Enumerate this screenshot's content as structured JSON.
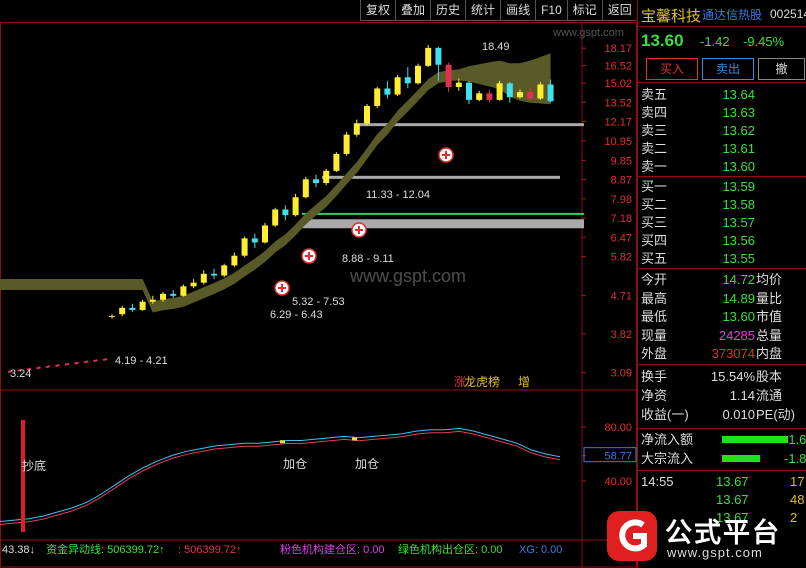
{
  "toolbar": [
    "复权",
    "叠加",
    "历史",
    "统计",
    "画线",
    "F10",
    "标记",
    "返回"
  ],
  "stock": {
    "name": "宝馨科技",
    "tag": "通达信热股",
    "code": "002514",
    "price": "13.60",
    "change": "-1.42",
    "pct": "-9.45%"
  },
  "trade_buttons": [
    "买入",
    "卖出",
    "撤"
  ],
  "asks": [
    {
      "label": "卖五",
      "price": "13.64"
    },
    {
      "label": "卖四",
      "price": "13.63"
    },
    {
      "label": "卖三",
      "price": "13.62"
    },
    {
      "label": "卖二",
      "price": "13.61"
    },
    {
      "label": "卖一",
      "price": "13.60"
    }
  ],
  "bids": [
    {
      "label": "买一",
      "price": "13.59"
    },
    {
      "label": "买二",
      "price": "13.58"
    },
    {
      "label": "买三",
      "price": "13.57"
    },
    {
      "label": "买四",
      "price": "13.56"
    },
    {
      "label": "买五",
      "price": "13.55"
    }
  ],
  "stats": [
    {
      "label": "今开",
      "value": "14.72",
      "label2": "均价"
    },
    {
      "label": "最高",
      "value": "14.89",
      "label2": "量比"
    },
    {
      "label": "最低",
      "value": "13.60",
      "label2": "市值"
    },
    {
      "label": "现量",
      "value": "24285",
      "label2": "总量"
    },
    {
      "label": "外盘",
      "value": "373074",
      "label2": "内盘"
    }
  ],
  "stats2": [
    {
      "label": "换手",
      "value": "15.54%",
      "label2": "股本"
    },
    {
      "label": "净资",
      "value": "1.14",
      "label2": "流通"
    },
    {
      "label": "收益(一)",
      "value": "0.010",
      "label2": "PE(动)"
    }
  ],
  "flows": [
    {
      "label": "净流入额",
      "value": "-1.6"
    },
    {
      "label": "大宗流入",
      "value": "-1.8"
    }
  ],
  "ticks": [
    {
      "time": "14:55",
      "price": "13.67",
      "vol": "17"
    },
    {
      "time": "",
      "price": "13.67",
      "vol": "48"
    },
    {
      "time": "",
      "price": "13.67",
      "vol": "2"
    }
  ],
  "price_axis": [
    "18.17",
    "16.52",
    "15.02",
    "13.52",
    "12.17",
    "10.95",
    "9.85",
    "8.87",
    "7.98",
    "7.18",
    "6.47",
    "5.82",
    "4.71",
    "3.82",
    "3.09"
  ],
  "ind_axis": [
    "80.00",
    "58.77",
    "40.00"
  ],
  "annotations": {
    "high": "18.49",
    "low": "3.24",
    "r1": "11.33 - 12.04",
    "r2": "8.88 - 9.11",
    "r3": "5.32 - 7.53",
    "r4": "6.29 - 6.43",
    "r5": "4.19 - 4.21",
    "zt": "涨",
    "bang": "龙虎榜",
    "zeng": "增"
  },
  "signals": [
    "抄底",
    "加仓",
    "加仓"
  ],
  "legend": {
    "prefix": "43.38↓",
    "s1": "资金异动线: 506399.72↑",
    "s2": ": 506399.72↑",
    "s3": "粉色机构建仓区: 0.00",
    "s4": "绿色机构出仓区: 0.00",
    "s5": "XG: 0.00"
  },
  "logo": {
    "name": "公式平台",
    "url": "www.gspt.com"
  },
  "watermark": "www.gspt.com",
  "chart_data": {
    "type": "candlestick",
    "candles": [
      [
        4.19,
        4.21,
        4.15,
        4.25
      ],
      [
        4.25,
        4.4,
        4.2,
        4.45
      ],
      [
        4.4,
        4.35,
        4.3,
        4.5
      ],
      [
        4.35,
        4.55,
        4.33,
        4.6
      ],
      [
        4.55,
        4.6,
        4.5,
        4.7
      ],
      [
        4.6,
        4.75,
        4.55,
        4.8
      ],
      [
        4.75,
        4.7,
        4.65,
        4.85
      ],
      [
        4.7,
        4.95,
        4.68,
        5.0
      ],
      [
        4.95,
        5.05,
        4.9,
        5.15
      ],
      [
        5.05,
        5.3,
        5.0,
        5.4
      ],
      [
        5.3,
        5.25,
        5.15,
        5.45
      ],
      [
        5.25,
        5.55,
        5.2,
        5.6
      ],
      [
        5.55,
        5.85,
        5.5,
        5.95
      ],
      [
        5.85,
        6.43,
        5.8,
        6.5
      ],
      [
        6.43,
        6.29,
        6.1,
        6.6
      ],
      [
        6.29,
        6.9,
        6.25,
        7.0
      ],
      [
        6.9,
        7.53,
        6.85,
        7.6
      ],
      [
        7.53,
        7.3,
        7.1,
        7.7
      ],
      [
        7.3,
        8.05,
        7.25,
        8.2
      ],
      [
        8.05,
        8.88,
        8.0,
        9.0
      ],
      [
        8.88,
        8.7,
        8.5,
        9.11
      ],
      [
        8.7,
        9.3,
        8.6,
        9.4
      ],
      [
        9.3,
        10.2,
        9.25,
        10.3
      ],
      [
        10.2,
        11.33,
        10.1,
        11.5
      ],
      [
        11.33,
        12.04,
        11.2,
        12.3
      ],
      [
        12.04,
        13.25,
        11.9,
        13.4
      ],
      [
        13.25,
        14.58,
        13.1,
        14.7
      ],
      [
        14.58,
        14.1,
        13.8,
        15.2
      ],
      [
        14.1,
        15.5,
        14.0,
        15.7
      ],
      [
        15.5,
        15.0,
        14.6,
        16.4
      ],
      [
        15.0,
        16.5,
        14.9,
        16.7
      ],
      [
        16.5,
        18.2,
        16.4,
        18.49
      ],
      [
        18.2,
        16.6,
        15.2,
        18.3
      ],
      [
        16.6,
        14.7,
        14.3,
        16.8
      ],
      [
        14.7,
        15.05,
        14.4,
        15.4
      ],
      [
        15.05,
        13.7,
        13.4,
        15.2
      ],
      [
        13.7,
        14.2,
        13.6,
        14.4
      ],
      [
        14.2,
        13.7,
        13.5,
        14.5
      ],
      [
        13.7,
        15.0,
        13.65,
        15.2
      ],
      [
        15.0,
        13.9,
        13.5,
        15.1
      ],
      [
        13.9,
        14.3,
        13.8,
        14.5
      ],
      [
        14.3,
        13.8,
        13.7,
        14.6
      ],
      [
        13.8,
        14.9,
        13.7,
        15.1
      ],
      [
        14.9,
        13.6,
        13.5,
        15.3
      ]
    ],
    "indicator": [
      10,
      11,
      12,
      14,
      17,
      20,
      24,
      30,
      37,
      44,
      50,
      55,
      59,
      62,
      64,
      66,
      67,
      68,
      68,
      69,
      70,
      70,
      71,
      72,
      73,
      72,
      73,
      74,
      75,
      77,
      78,
      78,
      79,
      77,
      74,
      71,
      68,
      63,
      60,
      58
    ]
  }
}
